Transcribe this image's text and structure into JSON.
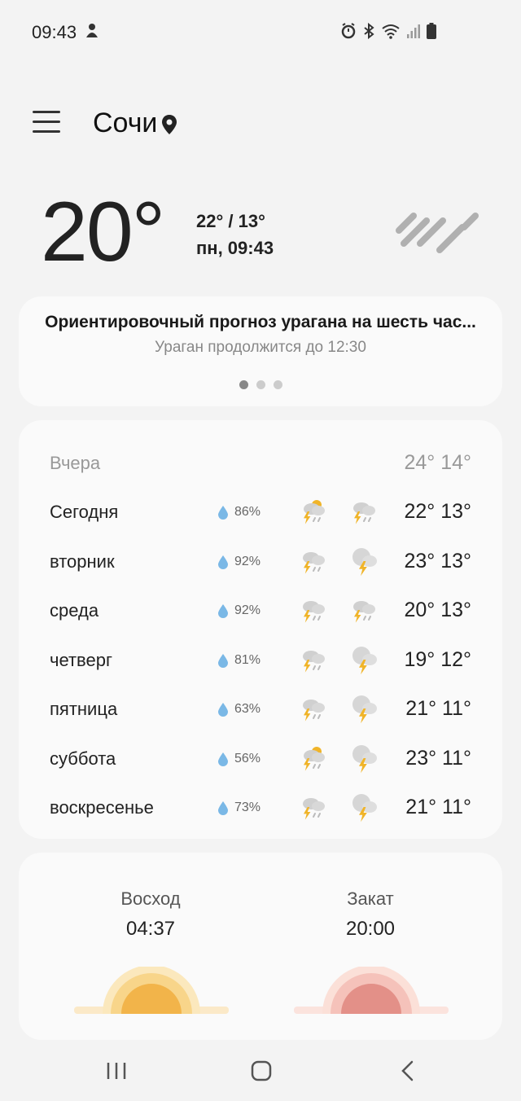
{
  "status": {
    "time": "09:43"
  },
  "header": {
    "city": "Сочи"
  },
  "current": {
    "temp": "20°",
    "hi_lo": "22° / 13°",
    "datetime": "пн, 09:43"
  },
  "alert": {
    "title": "Ориентировочный прогноз урагана на шесть час...",
    "subtitle": "Ураган продолжится до 12:30",
    "pages": 3,
    "active_page": 0
  },
  "forecast": {
    "yesterday": {
      "label": "Вчера",
      "temps": "24° 14°"
    },
    "days": [
      {
        "label": "Сегодня",
        "precip": "86%",
        "day_icon": "thunder-rain-sun-icon",
        "night_icon": "thunder-rain-icon",
        "temps": "22° 13°"
      },
      {
        "label": "вторник",
        "precip": "92%",
        "day_icon": "thunder-rain-icon",
        "night_icon": "thunder-cloud-icon",
        "temps": "23° 13°"
      },
      {
        "label": "среда",
        "precip": "92%",
        "day_icon": "thunder-rain-icon",
        "night_icon": "thunder-rain-icon",
        "temps": "20° 13°"
      },
      {
        "label": "четверг",
        "precip": "81%",
        "day_icon": "thunder-rain-icon",
        "night_icon": "thunder-cloud-icon",
        "temps": "19° 12°"
      },
      {
        "label": "пятница",
        "precip": "63%",
        "day_icon": "thunder-rain-icon",
        "night_icon": "thunder-cloud-icon",
        "temps": "21° 11°"
      },
      {
        "label": "суббота",
        "precip": "56%",
        "day_icon": "thunder-rain-sun-icon",
        "night_icon": "thunder-cloud-icon",
        "temps": "23° 11°"
      },
      {
        "label": "воскресенье",
        "precip": "73%",
        "day_icon": "thunder-rain-icon",
        "night_icon": "thunder-cloud-icon",
        "temps": "21° 11°"
      }
    ]
  },
  "sun": {
    "sunrise_label": "Восход",
    "sunrise_time": "04:37",
    "sunset_label": "Закат",
    "sunset_time": "20:00"
  },
  "colors": {
    "accent_sun": "#f2b44a",
    "sunset": "#e39088",
    "lightning": "#f0b429",
    "drop": "#7ab8e6"
  }
}
